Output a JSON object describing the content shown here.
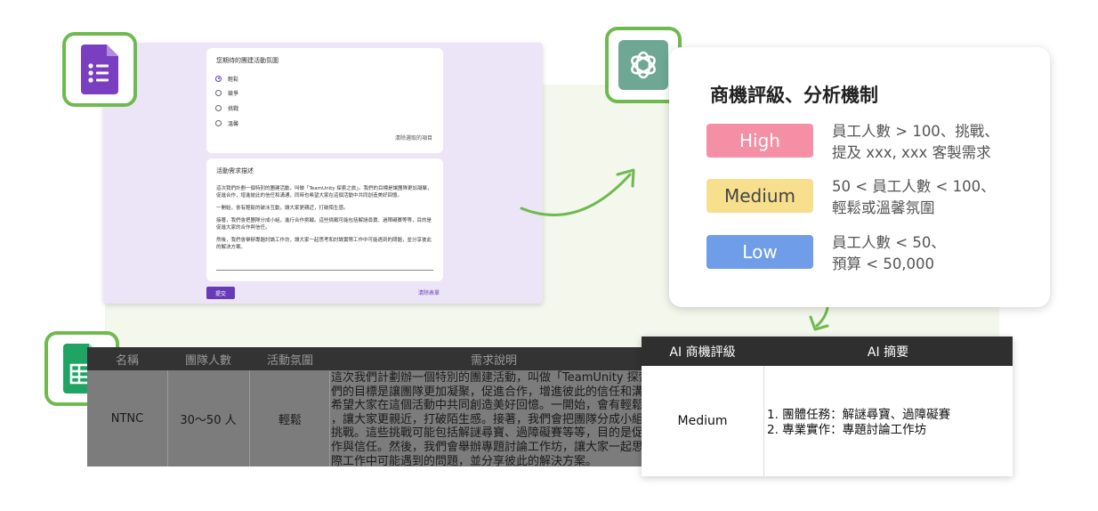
{
  "form": {
    "question_title": "您期待的團建活動氛圍",
    "options": [
      "輕鬆",
      "競爭",
      "挑戰",
      "溫馨"
    ],
    "selected_option": "輕鬆",
    "clear_selection": "清除選取的項目",
    "description_title": "活動需求描述",
    "description_paragraphs": [
      "這次我們計劃一個特別的團建活動，叫做「TeamUnity 探索之旅」。我們的目標是讓團隊更加凝聚，促進合作，增進彼此的信任和溝通，同時也希望大家在這個活動中共同創造美好回憶。",
      "一開始，會有輕鬆的破冰互動，讓大家更親近，打破陌生感。",
      "接著，我們會把團隊分成小組，進行合作挑戰。這些挑戰可能包括解謎尋寶、過障礙賽等等，目的是促進大家的合作與信任。",
      "然後，我們會舉辦專題討論工作坊，讓大家一起思考和討論實際工作中可能遇到的問題，並分享彼此的解決方案。"
    ],
    "submit_label": "提交",
    "clear_form_label": "清除表單"
  },
  "rating": {
    "title": "商機評級、分析機制",
    "levels": [
      {
        "label": "High",
        "rule_line1": "員工人數 > 100、挑戰、",
        "rule_line2": "提及 xxx, xxx 客製需求"
      },
      {
        "label": "Medium",
        "rule_line1": "50 < 員工人數 < 100、",
        "rule_line2": "輕鬆或溫馨氛圍"
      },
      {
        "label": "Low",
        "rule_line1": "員工人數 < 50、",
        "rule_line2": "預算 < 50,000"
      }
    ]
  },
  "sheet": {
    "headers": [
      "名稱",
      "團隊人數",
      "活動氛圍",
      "需求說明"
    ],
    "row": {
      "name": "NTNC",
      "team_size": "30～50 人",
      "atmosphere": "輕鬆",
      "description_lines": [
        "這次我們計劃辦一個特別的團建活動，叫做「TeamUnity 探索之旅",
        "們的目標是讓團隊更加凝聚，促進合作，增進彼此的信任和溝通，",
        "希望大家在這個活動中共同創造美好回憶。一開始，會有輕鬆的破",
        "，讓大家更親近，打破陌生感。接著，我們會把團隊分成小組，進",
        "挑戰。這些挑戰可能包括解謎尋寶、過障礙賽等等，目的是促進大",
        "作與信任。然後，我們會舉辦專題討論工作坊，讓大家一起思考和",
        "際工作中可能遇到的問題，並分享彼此的解決方案。"
      ]
    }
  },
  "ai_result": {
    "headers": [
      "AI 商機評級",
      "AI 摘要"
    ],
    "rating": "Medium",
    "summary_lines": [
      "1. 團體任務：解謎尋寶、過障礙賽",
      "2. 專業實作：專題討論工作坊"
    ]
  },
  "icons": {
    "forms_icon": "google-forms-icon",
    "chatgpt_icon": "chatgpt-icon",
    "sheets_icon": "google-sheets-icon"
  },
  "colors": {
    "accent_green": "#6fba4f",
    "form_purple": "#673ab7",
    "high": "#f48fa6",
    "medium": "#f7df8d",
    "low": "#6f9de8"
  }
}
